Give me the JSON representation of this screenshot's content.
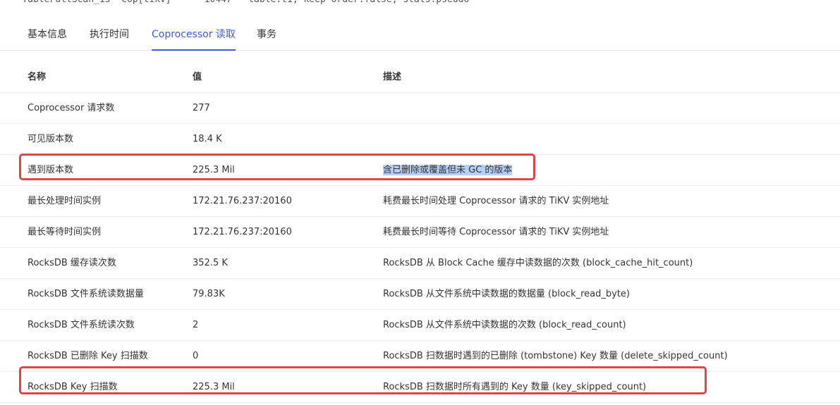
{
  "top_partial_text": "    TableFullScan_15  cop[tikv]      10447   table:t1, keep order:false, stats:pseudo",
  "tabs": [
    {
      "label": "基本信息",
      "active": false
    },
    {
      "label": "执行时间",
      "active": false
    },
    {
      "label": "Coprocessor 读取",
      "active": true
    },
    {
      "label": "事务",
      "active": false
    }
  ],
  "table": {
    "headers": [
      "名称",
      "值",
      "描述"
    ],
    "rows": [
      {
        "name": "Coprocessor 请求数",
        "value": "277",
        "desc": ""
      },
      {
        "name": "可见版本数",
        "value": "18.4 K",
        "desc": ""
      },
      {
        "name": "遇到版本数",
        "value": "225.3 Mil",
        "desc": "含已删除或覆盖但未 GC 的版本",
        "highlighted": true
      },
      {
        "name": "最长处理时间实例",
        "value": "172.21.76.237:20160",
        "desc": "耗费最长时间处理 Coprocessor 请求的 TiKV 实例地址"
      },
      {
        "name": "最长等待时间实例",
        "value": "172.21.76.237:20160",
        "desc": "耗费最长时间等待 Coprocessor 请求的 TiKV 实例地址"
      },
      {
        "name": "RocksDB 缓存读次数",
        "value": "352.5 K",
        "desc": "RocksDB 从 Block Cache 缓存中读数据的次数 (block_cache_hit_count)"
      },
      {
        "name": "RocksDB 文件系统读数据量",
        "value": "79.83K",
        "desc": "RocksDB 从文件系统中读数据的数据量 (block_read_byte)"
      },
      {
        "name": "RocksDB 文件系统读次数",
        "value": "2",
        "desc": "RocksDB 从文件系统中读数据的次数 (block_read_count)"
      },
      {
        "name": "RocksDB 已删除 Key 扫描数",
        "value": "0",
        "desc": "RocksDB 扫数据时遇到的已删除 (tombstone) Key 数量 (delete_skipped_count)"
      },
      {
        "name": "RocksDB Key 扫描数",
        "value": "225.3 Mil",
        "desc": "RocksDB 扫数据时所有遇到的 Key 数量 (key_skipped_count)"
      }
    ]
  },
  "annotation_color": "#e04545",
  "accent_color": "#3b5bdb",
  "selection_color": "#b4d0f5"
}
